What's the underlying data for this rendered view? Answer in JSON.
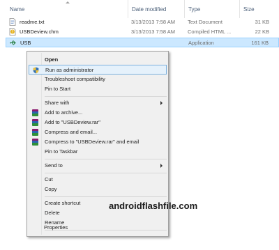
{
  "columns": {
    "name": "Name",
    "date": "Date modified",
    "type": "Type",
    "size": "Size"
  },
  "files": [
    {
      "name": "readme.txt",
      "date": "3/13/2013 7:58 AM",
      "type": "Text Document",
      "size": "31 KB",
      "icon": "text-file-icon"
    },
    {
      "name": "USBDeview.chm",
      "date": "3/13/2013 7:58 AM",
      "type": "Compiled HTML ...",
      "size": "22 KB",
      "icon": "help-file-icon"
    },
    {
      "name": "USB",
      "type": "Application",
      "size": "161 KB",
      "icon": "usb-app-icon",
      "selected": true
    }
  ],
  "menu": {
    "items": {
      "open": "Open",
      "run_as_admin": "Run as administrator",
      "troubleshoot": "Troubleshoot compatibility",
      "pin_start": "Pin to Start",
      "share_with": "Share with",
      "add_archive": "Add to archive...",
      "add_rar": "Add to \"USBDeview.rar\"",
      "compress_email": "Compress and email...",
      "compress_rar_email": "Compress to \"USBDeview.rar\" and email",
      "pin_taskbar": "Pin to Taskbar",
      "send_to": "Send to",
      "cut": "Cut",
      "copy": "Copy",
      "create_shortcut": "Create shortcut",
      "delete": "Delete",
      "rename": "Rename",
      "properties": "Properties"
    }
  },
  "watermark": "androidflashfile.com",
  "colors": {
    "selection_bg": "#cce8ff",
    "menu_bg": "#f0f0f0",
    "highlight": "#e5f1fb",
    "header_text": "#4c607a"
  }
}
